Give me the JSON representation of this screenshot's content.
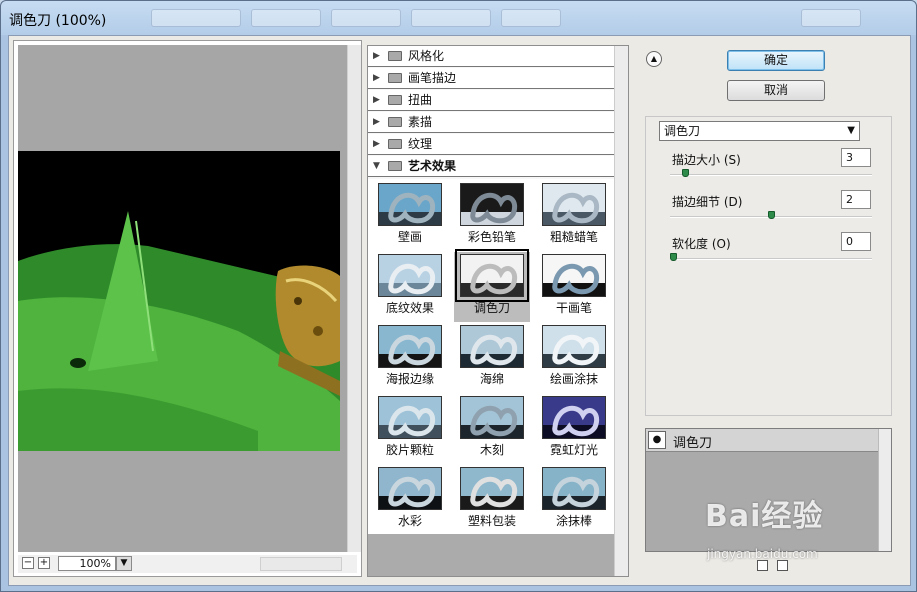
{
  "window": {
    "title": "调色刀 (100%)"
  },
  "preview": {
    "zoom": "100%"
  },
  "gallery": {
    "categories": [
      {
        "label": "风格化"
      },
      {
        "label": "画笔描边"
      },
      {
        "label": "扭曲"
      },
      {
        "label": "素描"
      },
      {
        "label": "纹理"
      },
      {
        "label": "艺术效果"
      }
    ],
    "filters": [
      {
        "label": "壁画"
      },
      {
        "label": "彩色铅笔"
      },
      {
        "label": "粗糙蜡笔"
      },
      {
        "label": "底纹效果"
      },
      {
        "label": "调色刀"
      },
      {
        "label": "干画笔"
      },
      {
        "label": "海报边缘"
      },
      {
        "label": "海绵"
      },
      {
        "label": "绘画涂抹"
      },
      {
        "label": "胶片颗粒"
      },
      {
        "label": "木刻"
      },
      {
        "label": "霓虹灯光"
      },
      {
        "label": "水彩"
      },
      {
        "label": "塑料包装"
      },
      {
        "label": "涂抹棒"
      }
    ],
    "selected_filter": "调色刀"
  },
  "buttons": {
    "ok": "确定",
    "cancel": "取消"
  },
  "settings": {
    "filter_select": "调色刀",
    "params": [
      {
        "label": "描边大小 (S)",
        "value": "3",
        "slider": 0.06
      },
      {
        "label": "描边细节 (D)",
        "value": "2",
        "slider": 0.5
      },
      {
        "label": "软化度 (O)",
        "value": "0",
        "slider": 0.0
      }
    ]
  },
  "layers": {
    "items": [
      {
        "label": "调色刀"
      }
    ]
  },
  "watermark": {
    "logo": "Bai经验",
    "sub": "jingyan.baidu.com"
  },
  "icons": {
    "collapse": "collapse-up-icon",
    "eye": "eye-icon",
    "folder": "folder-icon",
    "new_layer": "new-layer-icon",
    "delete_layer": "trash-icon"
  }
}
